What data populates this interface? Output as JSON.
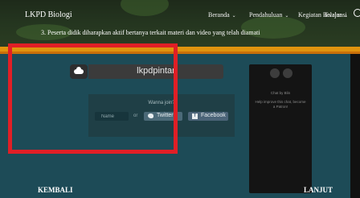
{
  "header": {
    "brand": "LKPD Biologi",
    "menu": [
      {
        "label": "Beranda"
      },
      {
        "label": "Pendahuluan"
      },
      {
        "label": "Kegiatan Belajar"
      },
      {
        "label": "Evaluasi"
      }
    ],
    "instruction": "3. Peserta didik diharapkan aktif bertanya terkait materi dan video yang telah diamati"
  },
  "colors": {
    "accent_orange": "#e0940f",
    "content_bg": "#1d4b57",
    "highlight_red": "#e01f26"
  },
  "widget": {
    "title": "lkpdpintar",
    "join_label": "Wanna join?",
    "name_placeholder": "Name",
    "or_text": "or",
    "twitter_label": "Twitter",
    "facebook_label": "Facebook",
    "fine_print": "",
    "side_panel": {
      "line1": "Chat by Blin",
      "line2": "Help improve this chat, become a Patron!"
    }
  },
  "footer": {
    "back_label": "KEMBALI",
    "next_label": "LANJUT"
  }
}
